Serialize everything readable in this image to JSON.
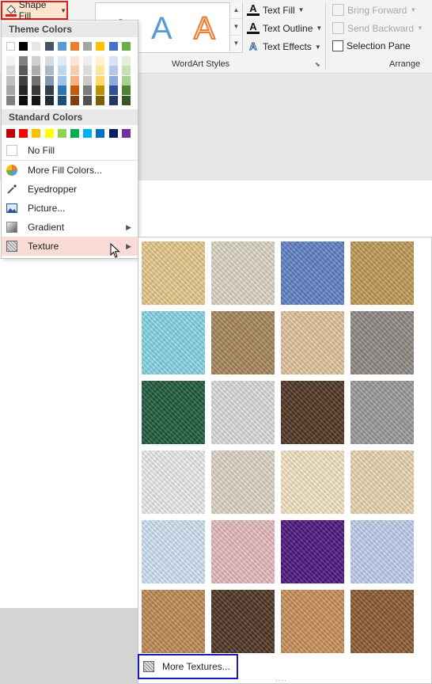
{
  "ribbon": {
    "shape_fill": "Shape Fill",
    "wordart_letter": "A",
    "text_fill": "Text Fill",
    "text_outline": "Text Outline",
    "text_effects": "Text Effects",
    "wordart_group": "WordArt Styles",
    "bring_forward": "Bring Forward",
    "send_backward": "Send Backward",
    "selection_pane": "Selection Pane",
    "arrange_group": "Arrange"
  },
  "menu": {
    "theme_colors_header": "Theme Colors",
    "standard_colors_header": "Standard Colors",
    "theme_top": [
      "#ffffff",
      "#000000",
      "#e7e6e6",
      "#44546a",
      "#5b9bd5",
      "#ed7d31",
      "#a5a5a5",
      "#ffc000",
      "#4472c4",
      "#70ad47"
    ],
    "theme_shades": [
      [
        "#f2f2f2",
        "#d9d9d9",
        "#bfbfbf",
        "#a6a6a6",
        "#808080"
      ],
      [
        "#7f7f7f",
        "#595959",
        "#404040",
        "#262626",
        "#0d0d0d"
      ],
      [
        "#d0cece",
        "#aeabab",
        "#757070",
        "#3a3838",
        "#171616"
      ],
      [
        "#d6dce4",
        "#adb9ca",
        "#8497b0",
        "#333f4f",
        "#222a35"
      ],
      [
        "#deebf6",
        "#bdd7ee",
        "#9dc3e6",
        "#2e75b5",
        "#1f4e79"
      ],
      [
        "#fbe5d5",
        "#f7cbac",
        "#f4b183",
        "#c55a11",
        "#833c0b"
      ],
      [
        "#ededed",
        "#dbdbdb",
        "#c9c9c9",
        "#7b7b7b",
        "#525252"
      ],
      [
        "#fff2cc",
        "#fee599",
        "#ffd965",
        "#bf9000",
        "#7f6000"
      ],
      [
        "#dae3f3",
        "#b4c7e7",
        "#8eaadb",
        "#2f5496",
        "#203864"
      ],
      [
        "#e2efd9",
        "#c5e0b3",
        "#a8d08d",
        "#538135",
        "#375623"
      ]
    ],
    "standard": [
      "#c00000",
      "#ff0000",
      "#ffc000",
      "#ffff00",
      "#92d050",
      "#00b050",
      "#00b0f0",
      "#0070c0",
      "#002060",
      "#7030a0"
    ],
    "items": [
      "No Fill",
      "More Fill Colors...",
      "Eyedropper",
      "Picture...",
      "Gradient",
      "Texture"
    ]
  },
  "textures": [
    [
      "papyrus",
      "canvas",
      "denim",
      "woven-mat"
    ],
    [
      "water-droplets",
      "paper-bag",
      "fish-fossil",
      "sand"
    ],
    [
      "green-marble",
      "white-marble",
      "brown-marble",
      "granite"
    ],
    [
      "newsprint",
      "recycled-paper",
      "parchment",
      "stationery"
    ],
    [
      "blue-tissue-paper",
      "pink-tissue-paper",
      "purple-mesh",
      "bouquet"
    ],
    [
      "cork",
      "walnut",
      "oak",
      "medium-wood"
    ]
  ],
  "texture_colors": [
    [
      "#e8c98a",
      "#ddd6c4",
      "#5f80c8",
      "#bf9a56"
    ],
    [
      "#86d6e6",
      "#a8865a",
      "#e3c49c",
      "#8f8983"
    ],
    [
      "#1d5a3a",
      "#dcdcdc",
      "#4f3421",
      "#9a9a9a"
    ],
    [
      "#ededed",
      "#ddd6c6",
      "#f6e5c4",
      "#ebd7af"
    ],
    [
      "#cfe3f5",
      "#e7bcbd",
      "#4c1480",
      "#c0cfee"
    ],
    [
      "#c08a52",
      "#4d3322",
      "#c99058",
      "#8a5a30"
    ]
  ],
  "more_textures": "More Textures...",
  "grip": "....",
  "cursor": "pointer-arrow"
}
